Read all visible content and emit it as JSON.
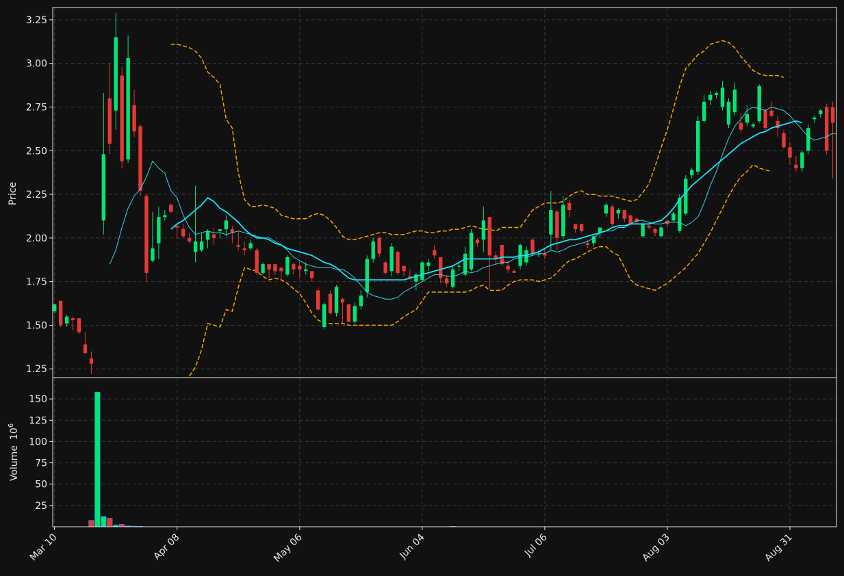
{
  "chart_data": {
    "type": "candlestick",
    "colors": {
      "background": "#111111",
      "up": "#00e676",
      "down": "#e53935",
      "ma_fast": "#36d7e8",
      "ma_slow": "#18e4ff",
      "bollinger": "#ffa500",
      "grid": "#3a3a3a",
      "axis": "#e8e8e8"
    },
    "price_panel": {
      "ylabel": "Price",
      "ylim": [
        1.2,
        3.32
      ],
      "yticks": [
        "1.25",
        "1.50",
        "1.75",
        "2.00",
        "2.25",
        "2.50",
        "2.75",
        "3.00",
        "3.25"
      ]
    },
    "volume_panel": {
      "ylabel": "Volume",
      "ylabel_exponent": "10",
      "ylabel_exponent_power": "6",
      "ylim": [
        0,
        175
      ],
      "yticks": [
        "25",
        "50",
        "75",
        "100",
        "125",
        "150"
      ]
    },
    "xlim": [
      -0.3,
      127.6
    ],
    "xticks": [
      {
        "idx": 0,
        "label": "Mar 10"
      },
      {
        "idx": 20,
        "label": "Apr 08"
      },
      {
        "idx": 40,
        "label": "May 06"
      },
      {
        "idx": 60,
        "label": "Jun 04"
      },
      {
        "idx": 80,
        "label": "Jul 06"
      },
      {
        "idx": 100,
        "label": "Aug 03"
      },
      {
        "idx": 120,
        "label": "Aug 31"
      }
    ],
    "candles": [
      [
        1.58,
        1.62,
        1.57,
        1.62
      ],
      [
        1.64,
        1.64,
        1.49,
        1.5
      ],
      [
        1.51,
        1.56,
        1.49,
        1.55
      ],
      [
        1.54,
        1.55,
        1.47,
        1.53
      ],
      [
        1.54,
        1.54,
        1.45,
        1.46
      ],
      [
        1.39,
        1.46,
        1.34,
        1.34
      ],
      [
        1.31,
        1.35,
        1.22,
        1.28
      ],
      [
        null,
        null,
        null,
        null
      ],
      [
        2.1,
        2.83,
        2.02,
        2.48
      ],
      [
        2.8,
        3.0,
        2.48,
        2.54
      ],
      [
        2.73,
        3.29,
        2.62,
        3.15
      ],
      [
        2.93,
        2.98,
        2.4,
        2.44
      ],
      [
        2.45,
        3.16,
        2.43,
        3.03
      ],
      [
        2.76,
        2.85,
        2.58,
        2.61
      ],
      [
        2.64,
        2.65,
        2.24,
        2.27
      ],
      [
        2.24,
        2.25,
        1.75,
        1.8
      ],
      [
        1.87,
        2.15,
        1.86,
        1.94
      ],
      [
        1.97,
        2.18,
        1.88,
        2.12
      ],
      [
        2.12,
        2.16,
        2.1,
        2.13
      ],
      [
        2.19,
        2.2,
        2.14,
        2.15
      ],
      [
        2.07,
        2.07,
        2.0,
        2.06
      ],
      [
        2.05,
        2.08,
        2.0,
        2.01
      ],
      [
        2.0,
        2.03,
        1.97,
        1.98
      ],
      [
        1.92,
        2.3,
        1.86,
        1.98
      ],
      [
        1.93,
        2.03,
        1.92,
        1.98
      ],
      [
        1.99,
        2.05,
        1.94,
        2.04
      ],
      [
        2.02,
        2.06,
        1.96,
        2.0
      ],
      [
        2.04,
        2.05,
        2.0,
        2.05
      ],
      [
        2.05,
        2.13,
        2.01,
        2.1
      ],
      [
        2.05,
        2.07,
        1.97,
        2.03
      ],
      [
        1.96,
        2.04,
        1.93,
        1.95
      ],
      [
        1.94,
        1.98,
        1.9,
        1.93
      ],
      [
        1.94,
        1.99,
        1.93,
        1.97
      ],
      [
        1.93,
        1.94,
        1.79,
        1.8
      ],
      [
        1.8,
        1.86,
        1.79,
        1.85
      ],
      [
        1.85,
        1.85,
        1.77,
        1.82
      ],
      [
        1.85,
        1.85,
        1.79,
        1.81
      ],
      [
        1.83,
        1.83,
        1.76,
        1.81
      ],
      [
        1.79,
        1.9,
        1.78,
        1.89
      ],
      [
        1.85,
        1.86,
        1.79,
        1.82
      ],
      [
        1.84,
        1.87,
        1.77,
        1.82
      ],
      [
        1.81,
        1.86,
        1.79,
        1.82
      ],
      [
        1.81,
        1.81,
        1.75,
        1.77
      ],
      [
        1.7,
        1.72,
        1.58,
        1.59
      ],
      [
        1.49,
        1.63,
        1.48,
        1.62
      ],
      [
        1.68,
        1.7,
        1.56,
        1.57
      ],
      [
        1.57,
        1.73,
        1.55,
        1.72
      ],
      [
        1.65,
        1.66,
        1.51,
        1.63
      ],
      [
        1.62,
        1.62,
        1.52,
        1.52
      ],
      [
        1.52,
        1.63,
        1.51,
        1.61
      ],
      [
        1.61,
        1.7,
        1.59,
        1.67
      ],
      [
        1.69,
        1.9,
        1.66,
        1.88
      ],
      [
        1.88,
        2.0,
        1.86,
        1.98
      ],
      [
        2.0,
        2.01,
        1.89,
        1.91
      ],
      [
        1.86,
        1.87,
        1.79,
        1.8
      ],
      [
        1.81,
        1.97,
        1.78,
        1.95
      ],
      [
        1.92,
        1.93,
        1.79,
        1.8
      ],
      [
        1.84,
        1.84,
        1.78,
        1.81
      ],
      [
        1.78,
        1.82,
        1.76,
        1.77
      ],
      [
        1.75,
        1.8,
        1.7,
        1.79
      ],
      [
        1.76,
        1.87,
        1.75,
        1.86
      ],
      [
        1.84,
        1.88,
        1.81,
        1.86
      ],
      [
        1.93,
        1.96,
        1.88,
        1.9
      ],
      [
        1.89,
        1.89,
        1.74,
        1.77
      ],
      [
        1.77,
        1.79,
        1.72,
        1.74
      ],
      [
        1.72,
        1.84,
        1.71,
        1.82
      ],
      [
        1.84,
        1.86,
        1.81,
        1.84
      ],
      [
        1.79,
        1.95,
        1.78,
        1.91
      ],
      [
        1.82,
        2.05,
        1.81,
        2.03
      ],
      [
        1.99,
        2.0,
        1.95,
        1.97
      ],
      [
        1.99,
        2.18,
        1.92,
        2.1
      ],
      [
        2.12,
        2.12,
        1.71,
        1.9
      ],
      [
        1.9,
        1.92,
        1.85,
        1.88
      ],
      [
        1.96,
        1.96,
        1.84,
        1.85
      ],
      [
        1.84,
        1.87,
        1.8,
        1.82
      ],
      [
        1.81,
        1.82,
        1.8,
        1.8
      ],
      [
        1.84,
        1.97,
        1.82,
        1.96
      ],
      [
        1.86,
        1.95,
        1.84,
        1.93
      ],
      [
        1.99,
        2.0,
        1.9,
        1.91
      ],
      [
        1.91,
        1.93,
        1.89,
        1.91
      ],
      [
        1.91,
        1.94,
        1.88,
        1.9
      ],
      [
        2.02,
        2.27,
        1.93,
        2.16
      ],
      [
        2.15,
        2.16,
        1.93,
        2.0
      ],
      [
        2.01,
        2.24,
        1.99,
        2.19
      ],
      [
        2.2,
        2.22,
        2.12,
        2.16
      ],
      [
        2.08,
        2.08,
        2.03,
        2.05
      ],
      [
        2.08,
        2.08,
        2.03,
        2.04
      ],
      [
        1.97,
        1.99,
        1.94,
        1.96
      ],
      [
        1.97,
        1.99,
        1.95,
        2.01
      ],
      [
        2.03,
        2.05,
        2.0,
        2.06
      ],
      [
        2.14,
        2.2,
        2.12,
        2.19
      ],
      [
        2.18,
        2.19,
        2.07,
        2.08
      ],
      [
        2.14,
        2.17,
        2.11,
        2.16
      ],
      [
        2.16,
        2.16,
        2.09,
        2.11
      ],
      [
        2.13,
        2.13,
        2.07,
        2.08
      ],
      [
        2.11,
        2.12,
        2.08,
        2.09
      ],
      [
        2.01,
        2.09,
        2.0,
        2.08
      ],
      [
        2.07,
        2.09,
        2.05,
        2.06
      ],
      [
        2.05,
        2.06,
        2.01,
        2.03
      ],
      [
        2.01,
        2.07,
        2.0,
        2.06
      ],
      [
        2.1,
        2.1,
        2.06,
        2.08
      ],
      [
        2.1,
        2.15,
        2.09,
        2.14
      ],
      [
        2.04,
        2.25,
        2.03,
        2.23
      ],
      [
        2.14,
        2.36,
        2.13,
        2.34
      ],
      [
        2.36,
        2.4,
        2.34,
        2.39
      ],
      [
        2.38,
        2.7,
        2.36,
        2.67
      ],
      [
        2.67,
        2.82,
        2.66,
        2.78
      ],
      [
        2.79,
        2.84,
        2.76,
        2.82
      ],
      [
        2.82,
        2.84,
        2.8,
        2.83
      ],
      [
        2.75,
        2.9,
        2.73,
        2.86
      ],
      [
        2.65,
        2.8,
        2.63,
        2.78
      ],
      [
        2.72,
        2.89,
        2.7,
        2.85
      ],
      [
        2.66,
        2.71,
        2.6,
        2.62
      ],
      [
        2.66,
        2.76,
        2.64,
        2.71
      ],
      [
        2.64,
        2.66,
        2.63,
        2.65
      ],
      [
        2.67,
        2.88,
        2.66,
        2.87
      ],
      [
        2.73,
        2.74,
        2.62,
        2.63
      ],
      [
        2.73,
        2.78,
        2.69,
        2.7
      ],
      [
        2.67,
        2.7,
        2.58,
        2.63
      ],
      [
        2.6,
        2.62,
        2.51,
        2.52
      ],
      [
        2.52,
        2.55,
        2.42,
        2.46
      ],
      [
        2.42,
        2.47,
        2.38,
        2.4
      ],
      [
        2.4,
        2.5,
        2.38,
        2.49
      ],
      [
        2.5,
        2.65,
        2.48,
        2.63
      ],
      [
        2.68,
        2.7,
        2.66,
        2.69
      ],
      [
        2.71,
        2.74,
        2.69,
        2.73
      ],
      [
        2.75,
        2.77,
        2.48,
        2.5
      ],
      [
        2.75,
        2.78,
        2.34,
        2.66
      ]
    ],
    "volume": [
      {
        "idx": 6,
        "value": 7.5
      },
      {
        "idx": 7,
        "value": 158
      },
      {
        "idx": 8,
        "value": 12
      },
      {
        "idx": 9,
        "value": 10
      },
      {
        "idx": 10,
        "value": 2
      },
      {
        "idx": 11,
        "value": 3
      },
      {
        "idx": 12,
        "value": 1
      },
      {
        "idx": 13,
        "value": 0.8
      },
      {
        "idx": 14,
        "value": 0.6
      },
      {
        "idx": 65,
        "value": 0.6
      }
    ],
    "ma_fast": {
      "start": 9,
      "values": [
        1.85,
        1.93,
        2.06,
        2.17,
        2.24,
        2.28,
        2.35,
        2.44,
        2.4,
        2.37,
        2.27,
        2.23,
        2.13,
        2.06,
        2.02,
        2.03,
        2.04,
        2.03,
        2.03,
        2.02,
        2.03,
        2.04,
        2.03,
        2.02,
        2.01,
        2.0,
        2.0,
        1.98,
        1.96,
        1.93,
        1.89,
        1.87,
        1.85,
        1.84,
        1.83,
        1.83,
        1.83,
        1.82,
        1.82,
        1.8,
        1.77,
        1.73,
        1.69,
        1.67,
        1.66,
        1.65,
        1.65,
        1.66,
        1.69,
        1.71,
        1.73,
        1.75,
        1.77,
        1.79,
        1.79,
        1.78,
        1.78,
        1.79,
        1.81,
        1.8,
        1.81,
        1.83,
        1.84,
        1.85,
        1.86,
        1.86,
        1.88,
        1.89,
        1.89,
        1.9,
        1.91,
        1.91,
        1.93,
        1.92,
        1.93,
        1.95,
        1.96,
        1.97,
        1.98,
        2.0,
        2.03,
        2.04,
        2.04,
        2.06,
        2.06,
        2.08,
        2.1,
        2.1,
        2.09,
        2.08,
        2.08,
        2.09,
        2.09,
        2.09,
        2.07,
        2.09,
        2.12,
        2.2,
        2.3,
        2.38,
        2.48,
        2.57,
        2.64,
        2.68,
        2.73,
        2.75,
        2.74,
        2.73,
        2.75,
        2.74,
        2.73,
        2.7,
        2.66,
        2.62,
        2.58,
        2.56,
        2.57,
        2.58,
        2.6,
        2.59,
        2.57
      ]
    },
    "ma_slow": {
      "start": 19,
      "values": [
        2.05,
        2.08,
        2.1,
        2.13,
        2.16,
        2.19,
        2.23,
        2.21,
        2.17,
        2.15,
        2.12,
        2.09,
        2.05,
        2.02,
        2.0,
        2.0,
        1.99,
        1.97,
        1.96,
        1.94,
        1.93,
        1.92,
        1.91,
        1.9,
        1.88,
        1.86,
        1.85,
        1.83,
        1.8,
        1.77,
        1.76,
        1.76,
        1.76,
        1.76,
        1.76,
        1.76,
        1.76,
        1.76,
        1.76,
        1.77,
        1.78,
        1.79,
        1.8,
        1.81,
        1.82,
        1.83,
        1.84,
        1.86,
        1.88,
        1.88,
        1.88,
        1.88,
        1.88,
        1.88,
        1.89,
        1.89,
        1.89,
        1.9,
        1.9,
        1.91,
        1.92,
        1.94,
        1.96,
        1.97,
        1.98,
        1.99,
        1.99,
        2.0,
        2.01,
        2.02,
        2.03,
        2.04,
        2.06,
        2.07,
        2.07,
        2.08,
        2.08,
        2.08,
        2.08,
        2.09,
        2.1,
        2.13,
        2.17,
        2.22,
        2.26,
        2.3,
        2.33,
        2.36,
        2.39,
        2.42,
        2.45,
        2.48,
        2.51,
        2.54,
        2.56,
        2.58,
        2.6,
        2.61,
        2.63,
        2.64,
        2.65,
        2.66,
        2.67,
        2.66
      ]
    },
    "bollinger_upper": {
      "start": 19,
      "values": [
        3.11,
        3.11,
        3.1,
        3.09,
        3.07,
        3.03,
        2.95,
        2.92,
        2.88,
        2.68,
        2.63,
        2.37,
        2.22,
        2.18,
        2.18,
        2.19,
        2.18,
        2.17,
        2.13,
        2.12,
        2.11,
        2.11,
        2.11,
        2.13,
        2.14,
        2.13,
        2.1,
        2.06,
        2.01,
        1.99,
        1.99,
        2.0,
        2.01,
        2.02,
        2.03,
        2.03,
        2.02,
        2.02,
        2.02,
        2.03,
        2.04,
        2.04,
        2.03,
        2.03,
        2.04,
        2.04,
        2.05,
        2.05,
        2.06,
        2.07,
        2.06,
        2.05,
        2.05,
        2.04,
        2.06,
        2.06,
        2.06,
        2.06,
        2.11,
        2.16,
        2.18,
        2.2,
        2.2,
        2.2,
        2.21,
        2.24,
        2.26,
        2.27,
        2.25,
        2.25,
        2.24,
        2.24,
        2.24,
        2.23,
        2.22,
        2.21,
        2.22,
        2.26,
        2.31,
        2.41,
        2.52,
        2.62,
        2.74,
        2.87,
        2.97,
        3.01,
        3.05,
        3.07,
        3.11,
        3.12,
        3.13,
        3.12,
        3.09,
        3.04,
        3.0,
        2.96,
        2.94,
        2.93,
        2.93,
        2.93,
        2.92
      ]
    },
    "bollinger_lower": {
      "start": 22,
      "values": [
        1.21,
        1.26,
        1.36,
        1.51,
        1.5,
        1.49,
        1.59,
        1.58,
        1.72,
        1.83,
        1.82,
        1.81,
        1.78,
        1.76,
        1.77,
        1.76,
        1.74,
        1.71,
        1.68,
        1.63,
        1.57,
        1.53,
        1.51,
        1.51,
        1.51,
        1.51,
        1.5,
        1.5,
        1.5,
        1.5,
        1.5,
        1.5,
        1.5,
        1.5,
        1.52,
        1.55,
        1.57,
        1.59,
        1.64,
        1.69,
        1.69,
        1.69,
        1.69,
        1.69,
        1.69,
        1.69,
        1.7,
        1.72,
        1.73,
        1.7,
        1.7,
        1.7,
        1.73,
        1.75,
        1.76,
        1.76,
        1.76,
        1.75,
        1.76,
        1.77,
        1.8,
        1.84,
        1.87,
        1.88,
        1.9,
        1.92,
        1.94,
        1.95,
        1.95,
        1.92,
        1.9,
        1.83,
        1.76,
        1.73,
        1.72,
        1.71,
        1.7,
        1.72,
        1.74,
        1.77,
        1.8,
        1.83,
        1.87,
        1.91,
        1.97,
        2.03,
        2.1,
        2.17,
        2.24,
        2.3,
        2.35,
        2.38,
        2.42,
        2.4,
        2.39,
        2.38
      ]
    }
  }
}
